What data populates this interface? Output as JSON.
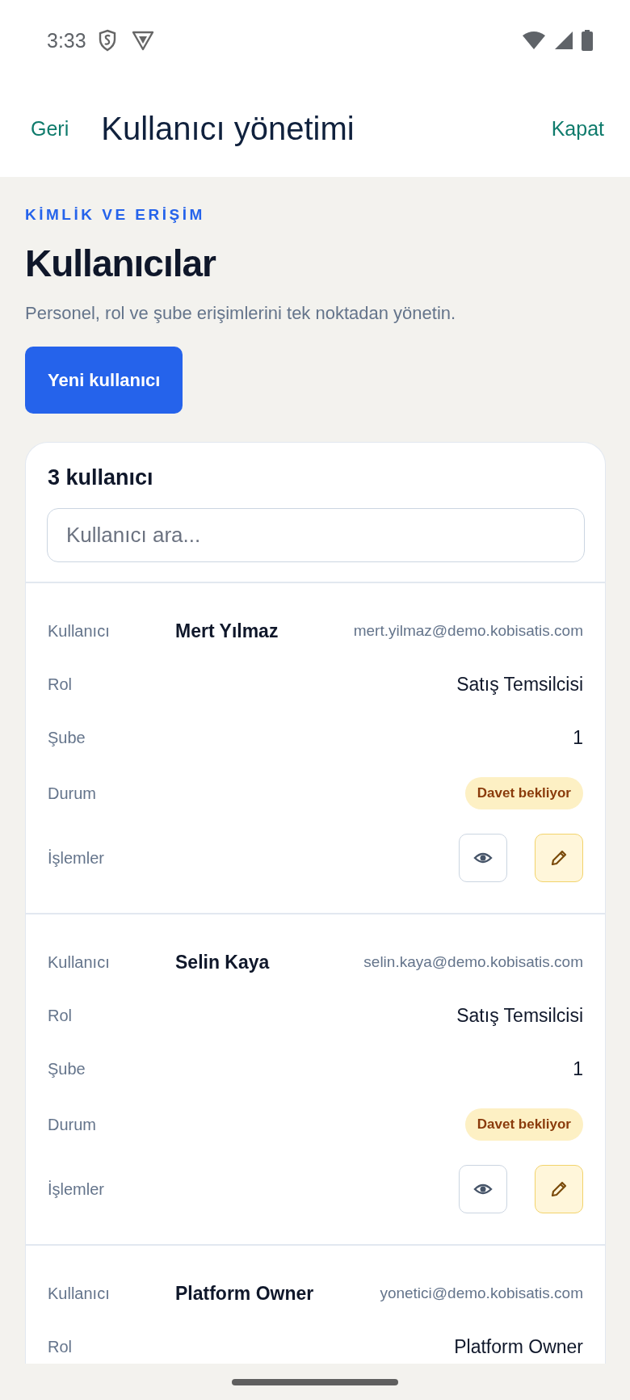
{
  "status_bar": {
    "time": "3:33"
  },
  "app_bar": {
    "back": "Geri",
    "title": "Kullanıcı yönetimi",
    "close": "Kapat"
  },
  "header": {
    "eyebrow": "KİMLİK VE ERİŞİM",
    "title": "Kullanıcılar",
    "subtitle": "Personel, rol ve şube erişimlerini tek noktadan yönetin.",
    "primary_button": "Yeni kullanıcı"
  },
  "users_panel": {
    "count": "3 kullanıcı",
    "search": {
      "placeholder": "Kullanıcı ara..."
    },
    "users": [
      {
        "rows": [
          {
            "kind": "user",
            "label": "Kullanıcı",
            "name": "Mert Yılmaz",
            "email": "mert.yilmaz@demo.kobisatis.com"
          },
          {
            "kind": "text",
            "label": "Rol",
            "value": "Satış Temsilcisi"
          },
          {
            "kind": "text",
            "label": "Şube",
            "value": "1"
          },
          {
            "kind": "status",
            "label": "Durum",
            "value": "Davet bekliyor",
            "color": "#fdf0c4"
          },
          {
            "kind": "actions",
            "label": "İşlemler",
            "actions": [
              {
                "kind": "view"
              },
              {
                "kind": "edit"
              }
            ]
          }
        ]
      },
      {
        "rows": [
          {
            "kind": "user",
            "label": "Kullanıcı",
            "name": "Selin Kaya",
            "email": "selin.kaya@demo.kobisatis.com"
          },
          {
            "kind": "text",
            "label": "Rol",
            "value": "Satış Temsilcisi"
          },
          {
            "kind": "text",
            "label": "Şube",
            "value": "1"
          },
          {
            "kind": "status",
            "label": "Durum",
            "value": "Davet bekliyor",
            "color": "#fdf0c4"
          },
          {
            "kind": "actions",
            "label": "İşlemler",
            "actions": [
              {
                "kind": "view"
              },
              {
                "kind": "edit"
              }
            ]
          }
        ]
      },
      {
        "rows": [
          {
            "kind": "user",
            "label": "Kullanıcı",
            "name": "Platform Owner",
            "email": "yonetici@demo.kobisatis.com"
          },
          {
            "kind": "text",
            "label": "Rol",
            "value": "Platform Owner"
          }
        ]
      }
    ]
  }
}
